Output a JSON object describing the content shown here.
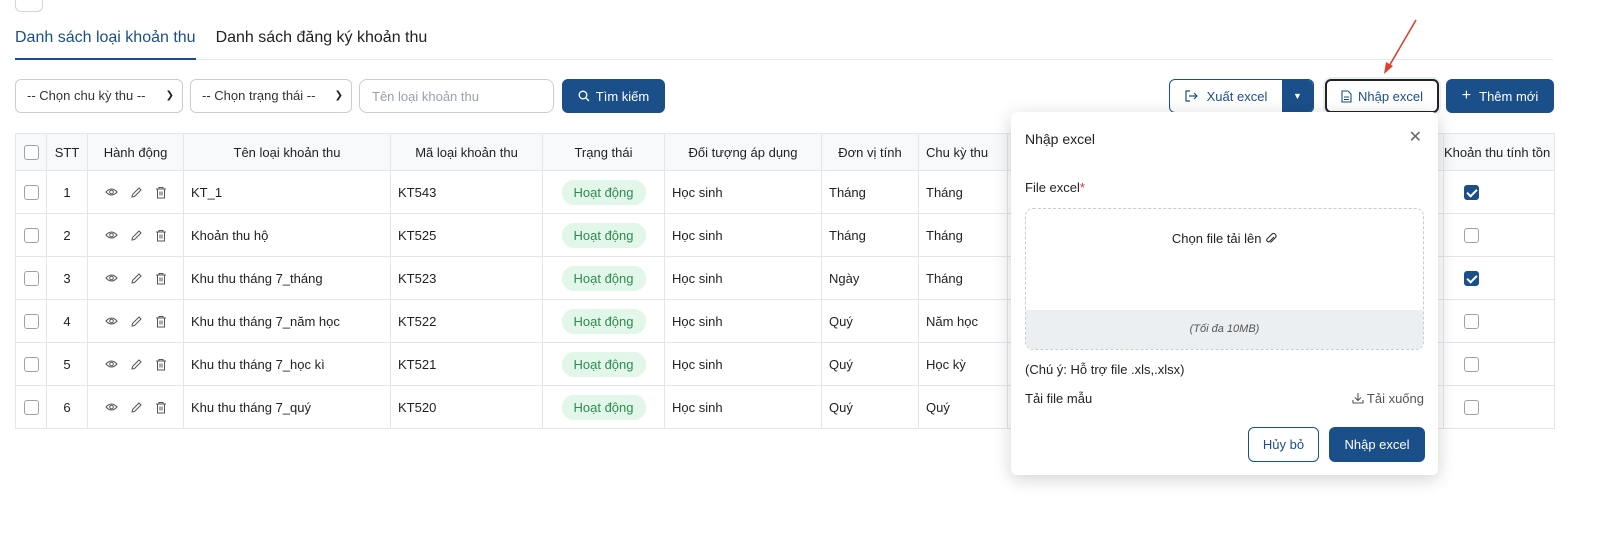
{
  "tabs": [
    {
      "label": "Danh sách loại khoản thu"
    },
    {
      "label": "Danh sách đăng ký khoản thu"
    }
  ],
  "filters": {
    "cycle_select": "-- Chọn chu kỳ thu --",
    "status_select": "-- Chọn trạng thái --",
    "name_placeholder": "Tên loại khoản thu",
    "search_label": "Tìm kiếm"
  },
  "actions": {
    "export_label": "Xuất excel",
    "import_label": "Nhập excel",
    "add_label": "Thêm mới"
  },
  "table": {
    "headers": [
      "STT",
      "Hành động",
      "Tên loại khoản thu",
      "Mã loại khoản thu",
      "Trạng thái",
      "Đối tượng áp dụng",
      "Đơn vị tính",
      "Chu kỳ thu",
      "Khoản thu tính tồn"
    ],
    "rows": [
      {
        "stt": "1",
        "name": "KT_1",
        "code": "KT543",
        "status": "Hoạt động",
        "target": "Học sinh",
        "unit": "Tháng",
        "cycle": "Tháng",
        "carry": true
      },
      {
        "stt": "2",
        "name": "Khoản thu hộ",
        "code": "KT525",
        "status": "Hoạt động",
        "target": "Học sinh",
        "unit": "Tháng",
        "cycle": "Tháng",
        "carry": false
      },
      {
        "stt": "3",
        "name": "Khu thu tháng 7_tháng",
        "code": "KT523",
        "status": "Hoạt động",
        "target": "Học sinh",
        "unit": "Ngày",
        "cycle": "Tháng",
        "carry": true
      },
      {
        "stt": "4",
        "name": "Khu thu tháng 7_năm học",
        "code": "KT522",
        "status": "Hoạt động",
        "target": "Học sinh",
        "unit": "Quý",
        "cycle": "Năm học",
        "carry": false
      },
      {
        "stt": "5",
        "name": "Khu thu tháng 7_học kì",
        "code": "KT521",
        "status": "Hoạt động",
        "target": "Học sinh",
        "unit": "Quý",
        "cycle": "Học kỳ",
        "carry": false
      },
      {
        "stt": "6",
        "name": "Khu thu tháng 7_quý",
        "code": "KT520",
        "status": "Hoạt động",
        "target": "Học sinh",
        "unit": "Quý",
        "cycle": "Quý",
        "carry": false
      }
    ]
  },
  "modal": {
    "title": "Nhập excel",
    "file_label": "File excel",
    "required_mark": "*",
    "choose_file": "Chọn file tải lên",
    "max_size": "(Tối đa 10MB)",
    "note": "(Chú ý: Hỗ trợ file .xls,.xlsx)",
    "template_label": "Tải file mẫu",
    "download_label": "Tải xuống",
    "cancel_label": "Hủy bỏ",
    "confirm_label": "Nhập excel"
  },
  "colors": {
    "primary": "#1b4f8a",
    "badge_bg": "#e3f6ea",
    "badge_text": "#2e8b50",
    "arrow": "#e0402f"
  }
}
